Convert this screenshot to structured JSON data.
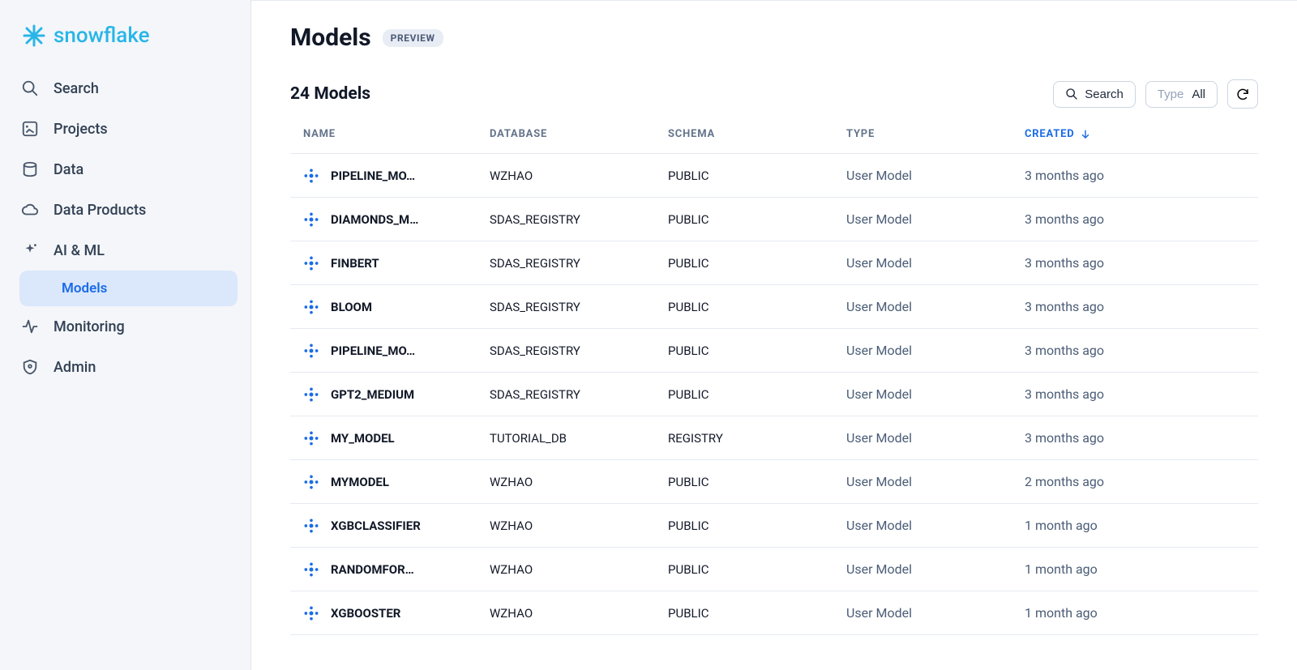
{
  "brand": "snowflake",
  "sidebar": {
    "items": [
      {
        "label": "Search",
        "icon": "search"
      },
      {
        "label": "Projects",
        "icon": "projects"
      },
      {
        "label": "Data",
        "icon": "data"
      },
      {
        "label": "Data Products",
        "icon": "cloud"
      },
      {
        "label": "AI & ML",
        "icon": "sparkle",
        "sub": [
          {
            "label": "Models",
            "active": true
          }
        ]
      },
      {
        "label": "Monitoring",
        "icon": "activity"
      },
      {
        "label": "Admin",
        "icon": "shield"
      }
    ]
  },
  "page": {
    "title": "Models",
    "badge": "PREVIEW",
    "count_label": "24 Models",
    "search_label": "Search",
    "type_filter_prefix": "Type",
    "type_filter_value": "All"
  },
  "table": {
    "columns": [
      "NAME",
      "DATABASE",
      "SCHEMA",
      "TYPE",
      "CREATED"
    ],
    "sort_column": "CREATED",
    "sort_direction": "desc",
    "rows": [
      {
        "name": "PIPELINE_MO…",
        "database": "WZHAO",
        "schema": "PUBLIC",
        "type": "User Model",
        "created": "3 months ago"
      },
      {
        "name": "DIAMONDS_M…",
        "database": "SDAS_REGISTRY",
        "schema": "PUBLIC",
        "type": "User Model",
        "created": "3 months ago"
      },
      {
        "name": "FINBERT",
        "database": "SDAS_REGISTRY",
        "schema": "PUBLIC",
        "type": "User Model",
        "created": "3 months ago"
      },
      {
        "name": "BLOOM",
        "database": "SDAS_REGISTRY",
        "schema": "PUBLIC",
        "type": "User Model",
        "created": "3 months ago"
      },
      {
        "name": "PIPELINE_MO…",
        "database": "SDAS_REGISTRY",
        "schema": "PUBLIC",
        "type": "User Model",
        "created": "3 months ago"
      },
      {
        "name": "GPT2_MEDIUM",
        "database": "SDAS_REGISTRY",
        "schema": "PUBLIC",
        "type": "User Model",
        "created": "3 months ago"
      },
      {
        "name": "MY_MODEL",
        "database": "TUTORIAL_DB",
        "schema": "REGISTRY",
        "type": "User Model",
        "created": "3 months ago"
      },
      {
        "name": "MYMODEL",
        "database": "WZHAO",
        "schema": "PUBLIC",
        "type": "User Model",
        "created": "2 months ago"
      },
      {
        "name": "XGBCLASSIFIER",
        "database": "WZHAO",
        "schema": "PUBLIC",
        "type": "User Model",
        "created": "1 month ago"
      },
      {
        "name": "RANDOMFOR…",
        "database": "WZHAO",
        "schema": "PUBLIC",
        "type": "User Model",
        "created": "1 month ago"
      },
      {
        "name": "XGBOOSTER",
        "database": "WZHAO",
        "schema": "PUBLIC",
        "type": "User Model",
        "created": "1 month ago"
      }
    ]
  }
}
